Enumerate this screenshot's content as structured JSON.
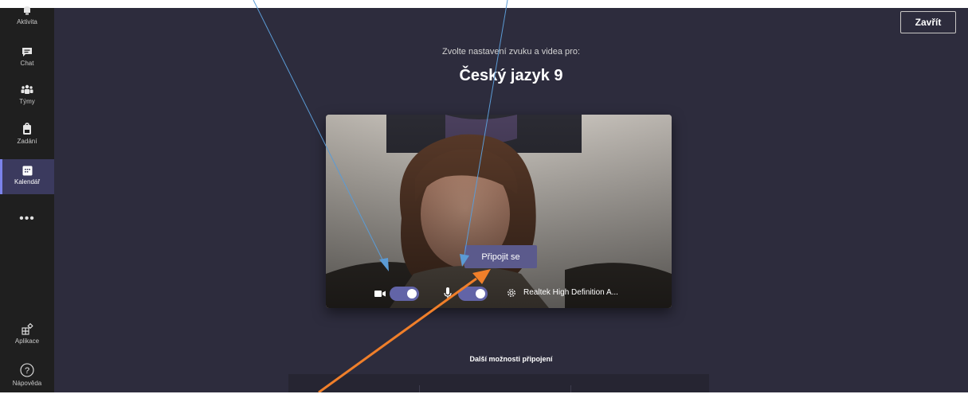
{
  "sidebar": {
    "items": [
      {
        "label": "Aktivita",
        "icon": "bell-icon"
      },
      {
        "label": "Chat",
        "icon": "chat-icon"
      },
      {
        "label": "Týmy",
        "icon": "teams-icon"
      },
      {
        "label": "Zadání",
        "icon": "assignments-icon"
      },
      {
        "label": "Kalendář",
        "icon": "calendar-icon",
        "active": true
      },
      {
        "label": "Aplikace",
        "icon": "apps-icon"
      },
      {
        "label": "Nápověda",
        "icon": "help-icon"
      }
    ],
    "more": "•••"
  },
  "header": {
    "close_label": "Zavřít"
  },
  "prejoin": {
    "subtitle": "Zvolte nastavení zvuku a videa pro:",
    "meeting_title": "Český jazyk 9",
    "join_label": "Připojit se",
    "camera_on": true,
    "mic_on": true,
    "audio_device": "Realtek High Definition A...",
    "more_options_label": "Další možnosti připojení"
  },
  "colors": {
    "accent": "#6264a7",
    "background": "#2d2c3d",
    "rail": "#1f1f1f",
    "arrow_blue": "#4a90d9",
    "arrow_orange": "#f07f2a"
  }
}
